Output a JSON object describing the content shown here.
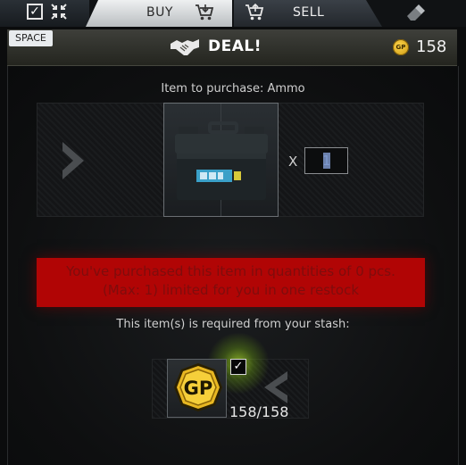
{
  "toolbar": {
    "buy_label": "BUY",
    "sell_label": "SELL",
    "icons": [
      "checkbox-icon",
      "collapse-icon",
      "cart-icon",
      "cart-icon",
      "eraser-icon"
    ]
  },
  "header": {
    "key_hint": "SPACE",
    "title": "DEAL!",
    "currency_icon_text": "GP",
    "balance": "158",
    "icons": [
      "handshake-icon",
      "gp-coin-icon"
    ]
  },
  "purchase": {
    "item_label": "Item to purchase: Ammo",
    "item_name": "Ammo",
    "multiplier": "X",
    "quantity": "1"
  },
  "warning": {
    "line1": "You've purchased this item in quantities of 0 pcs.",
    "line2": "(Max: 1) limited for you in one restock"
  },
  "requirements": {
    "label": "This item(s) is required from your stash:",
    "items": [
      {
        "icon": "gp-coin-icon",
        "icon_text": "GP",
        "count": "158/158",
        "checked": true
      }
    ]
  },
  "colors": {
    "warning_bg": "#b10505",
    "warning_text": "#7e0d0d",
    "gp_gold": "#e8b722",
    "glow": "#aadc28"
  }
}
